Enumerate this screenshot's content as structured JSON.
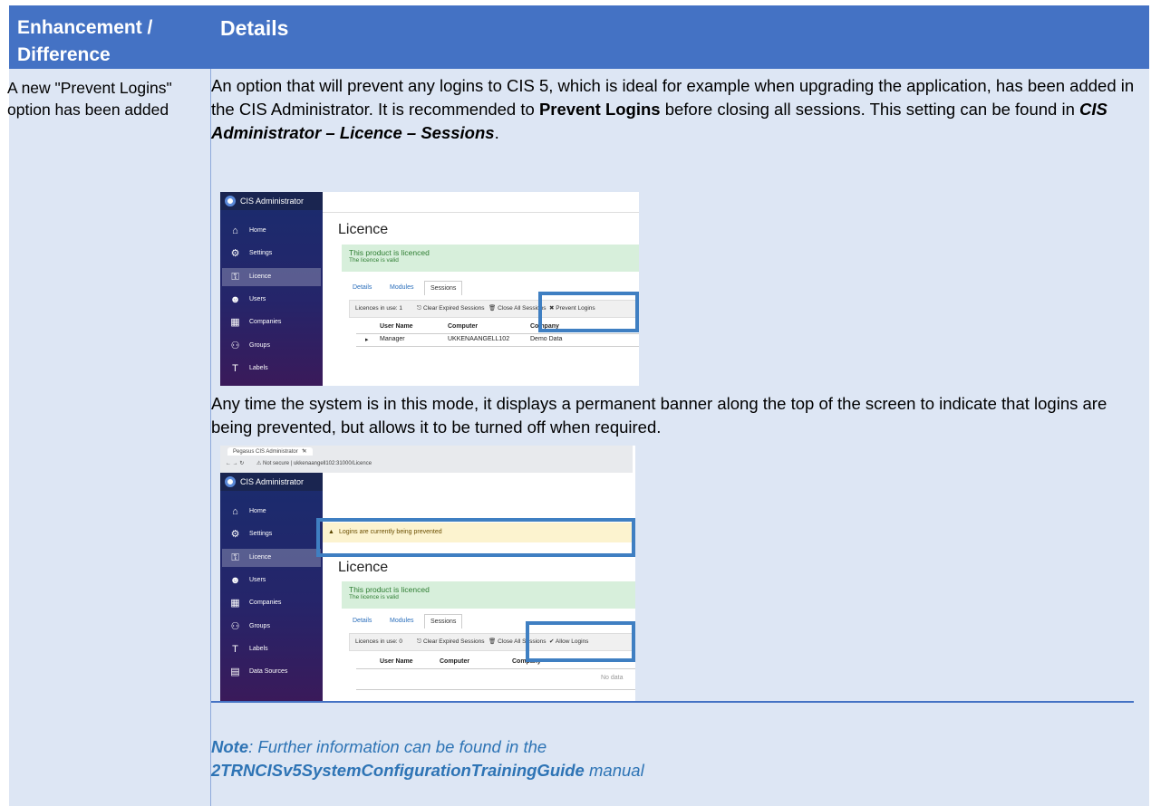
{
  "header": {
    "col1": "Enhancement / Difference",
    "col2": "Details"
  },
  "row": {
    "col1": "A new \"Prevent Logins\" option has been added",
    "para1_a": "An option that will prevent any logins to CIS 5, which is ideal for example when upgrading the application, has been added in the CIS Administrator.  It is recommended to ",
    "para1_b": "Prevent Logins",
    "para1_c": " before closing all sessions.  This setting can be found in ",
    "para1_d": "CIS Administrator – Licence – Sessions",
    "para1_e": ".",
    "para2": "Any time the system is in this mode, it displays a permanent banner along the top of the screen to indicate that logins are being prevented, but allows it to be turned off when required."
  },
  "screenshot1": {
    "app_title": "CIS Administrator",
    "sidebar": [
      {
        "label": "Home",
        "icon": "home-icon",
        "glyph": "⌂"
      },
      {
        "label": "Settings",
        "icon": "gear-icon",
        "glyph": "⚙"
      },
      {
        "label": "Licence",
        "icon": "key-icon",
        "glyph": "⚿"
      },
      {
        "label": "Users",
        "icon": "user-icon",
        "glyph": "☻"
      },
      {
        "label": "Companies",
        "icon": "building-icon",
        "glyph": "▦"
      },
      {
        "label": "Groups",
        "icon": "group-icon",
        "glyph": "⚇"
      },
      {
        "label": "Labels",
        "icon": "text-icon",
        "glyph": "T"
      }
    ],
    "page_title": "Licence",
    "status_title": "This product is licenced",
    "status_sub": "The licence is valid",
    "tabs": [
      "Details",
      "Modules",
      "Sessions"
    ],
    "toolbar": {
      "licences": "Licences in use: 1",
      "clear": "Clear Expired Sessions",
      "close_all": "Close All Sessions",
      "action": "Prevent Logins"
    },
    "columns": [
      "User Name",
      "Computer",
      "Company"
    ],
    "row": [
      "Manager",
      "UKKENAANGELL102",
      "Demo Data"
    ]
  },
  "screenshot2": {
    "browser_tab": "Pegasus CIS Administrator",
    "url_warning": "Not secure",
    "url": "ukkenaangell102:31000/Licence",
    "app_title": "CIS Administrator",
    "banner": "Logins are currently being prevented",
    "sidebar_extra": {
      "label": "Data Sources",
      "icon": "database-icon",
      "glyph": "▤"
    },
    "page_title": "Licence",
    "status_title": "This product is licenced",
    "status_sub": "The licence is valid",
    "tabs": [
      "Details",
      "Modules",
      "Sessions"
    ],
    "toolbar": {
      "licences": "Licences in use: 0",
      "clear": "Clear Expired Sessions",
      "close_all": "Close All Sessions",
      "action": "Allow Logins"
    },
    "columns": [
      "User Name",
      "Computer",
      "Company"
    ],
    "empty": "No data"
  },
  "note": {
    "label": "Note",
    "text_a": ": Further information can be found in the ",
    "manual": "2TRNCISv5SystemConfigurationTrainingGuide",
    "text_b": " manual"
  },
  "colors": {
    "header": "#4472c4",
    "cell": "#dde6f4",
    "highlight": "#3f7fc2",
    "note": "#2e74b5"
  }
}
